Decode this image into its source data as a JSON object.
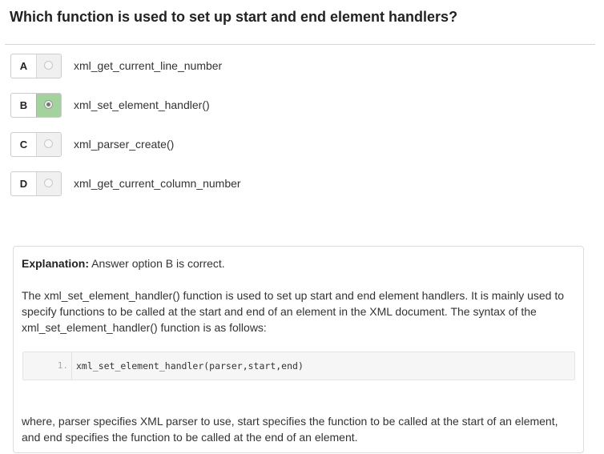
{
  "question": {
    "title": "Which function is used to set up start and end element handlers?"
  },
  "options": [
    {
      "letter": "A",
      "text": "xml_get_current_line_number",
      "selected": false
    },
    {
      "letter": "B",
      "text": "xml_set_element_handler()",
      "selected": true
    },
    {
      "letter": "C",
      "text": "xml_parser_create()",
      "selected": false
    },
    {
      "letter": "D",
      "text": "xml_get_current_column_number",
      "selected": false
    }
  ],
  "explanation": {
    "label": "Explanation:",
    "summary": " Answer option B is correct.",
    "paragraph": "The xml_set_element_handler() function is used to set up start and end element handlers. It is mainly used to specify functions to be called at the start and end of an element in the XML document. The syntax of the xml_set_element_handler() function is as follows:",
    "code": {
      "line_number": "1.",
      "line": "xml_set_element_handler(parser,start,end)"
    },
    "footer": "where, parser specifies XML parser to use, start specifies the function to be called at the start of an element, and end specifies the function to be called at the end of an element."
  },
  "colors": {
    "selected_option": "#a3d39c"
  }
}
